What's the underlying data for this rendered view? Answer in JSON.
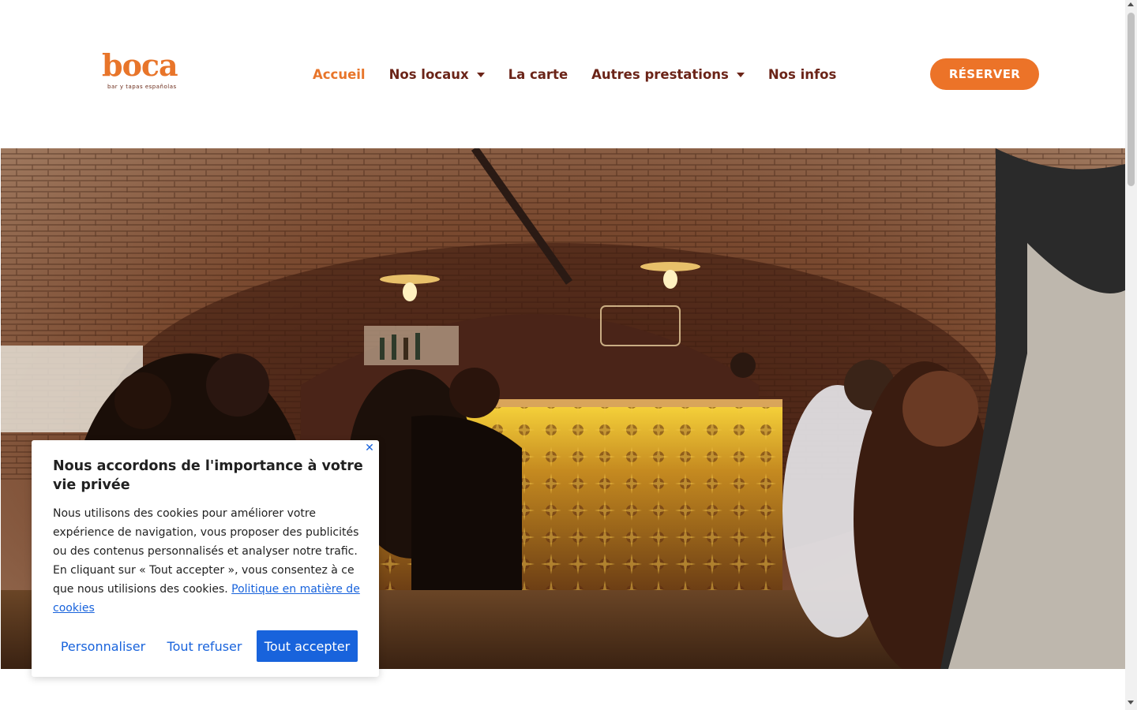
{
  "brand": {
    "logo_text": "boca",
    "logo_tagline": "bar y tapas españolas",
    "colors": {
      "accent": "#e8752a",
      "nav_text": "#6b2418",
      "cookie_blue": "#1863dc"
    }
  },
  "nav": {
    "items": [
      {
        "label": "Accueil",
        "active": true,
        "dropdown": false
      },
      {
        "label": "Nos locaux",
        "active": false,
        "dropdown": true
      },
      {
        "label": "La carte",
        "active": false,
        "dropdown": false
      },
      {
        "label": "Autres prestations",
        "active": false,
        "dropdown": true
      },
      {
        "label": "Nos infos",
        "active": false,
        "dropdown": false
      }
    ],
    "reserve_label": "RÉSERVER"
  },
  "hero": {
    "image": "photo of a brick-vaulted tapas bar with guests seated at a tiled bar counter"
  },
  "cookie_banner": {
    "title": "Nous accordons de l'importance à votre vie privée",
    "body": "Nous utilisons des cookies pour améliorer votre expérience de navigation, vous proposer des publicités ou des contenus personnalisés et analyser notre trafic. En cliquant sur « Tout accepter », vous consentez à ce que nous utilisions des cookies.",
    "policy_link": "Politique en matière de cookies",
    "close_icon": "close-icon",
    "customize_label": "Personnaliser",
    "reject_label": "Tout refuser",
    "accept_label": "Tout accepter"
  }
}
